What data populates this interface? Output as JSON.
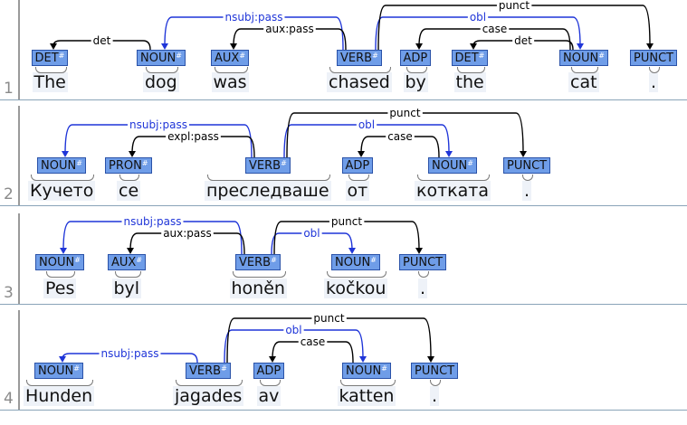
{
  "sentences": [
    {
      "num": "1",
      "tokens": [
        {
          "word": "The",
          "tag": "DET",
          "feat": true
        },
        {
          "word": "dog",
          "tag": "NOUN",
          "feat": true
        },
        {
          "word": "was",
          "tag": "AUX",
          "feat": true
        },
        {
          "word": "chased",
          "tag": "VERB",
          "feat": true
        },
        {
          "word": "by",
          "tag": "ADP",
          "feat": false
        },
        {
          "word": "the",
          "tag": "DET",
          "feat": true
        },
        {
          "word": "cat",
          "tag": "NOUN",
          "feat": true
        },
        {
          "word": ".",
          "tag": "PUNCT",
          "feat": false
        }
      ],
      "arcs": [
        {
          "from": 1,
          "to": 0,
          "label": "det",
          "color": "#000000"
        },
        {
          "from": 3,
          "to": 1,
          "label": "nsubj:pass",
          "color": "#1f35d8"
        },
        {
          "from": 3,
          "to": 2,
          "label": "aux:pass",
          "color": "#000000"
        },
        {
          "from": 6,
          "to": 5,
          "label": "det",
          "color": "#000000"
        },
        {
          "from": 6,
          "to": 4,
          "label": "case",
          "color": "#000000"
        },
        {
          "from": 3,
          "to": 6,
          "label": "obl",
          "color": "#1f35d8"
        },
        {
          "from": 3,
          "to": 7,
          "label": "punct",
          "color": "#000000"
        }
      ]
    },
    {
      "num": "2",
      "tokens": [
        {
          "word": "Кучето",
          "tag": "NOUN",
          "feat": true
        },
        {
          "word": "се",
          "tag": "PRON",
          "feat": true
        },
        {
          "word": "преследваше",
          "tag": "VERB",
          "feat": true
        },
        {
          "word": "от",
          "tag": "ADP",
          "feat": false
        },
        {
          "word": "котката",
          "tag": "NOUN",
          "feat": true
        },
        {
          "word": ".",
          "tag": "PUNCT",
          "feat": false
        }
      ],
      "arcs": [
        {
          "from": 2,
          "to": 0,
          "label": "nsubj:pass",
          "color": "#1f35d8"
        },
        {
          "from": 2,
          "to": 1,
          "label": "expl:pass",
          "color": "#000000"
        },
        {
          "from": 4,
          "to": 3,
          "label": "case",
          "color": "#000000"
        },
        {
          "from": 2,
          "to": 4,
          "label": "obl",
          "color": "#1f35d8"
        },
        {
          "from": 2,
          "to": 5,
          "label": "punct",
          "color": "#000000"
        }
      ]
    },
    {
      "num": "3",
      "tokens": [
        {
          "word": "Pes",
          "tag": "NOUN",
          "feat": true
        },
        {
          "word": "byl",
          "tag": "AUX",
          "feat": true
        },
        {
          "word": "honěn",
          "tag": "VERB",
          "feat": true
        },
        {
          "word": "kočkou",
          "tag": "NOUN",
          "feat": true
        },
        {
          "word": ".",
          "tag": "PUNCT",
          "feat": false
        }
      ],
      "arcs": [
        {
          "from": 2,
          "to": 0,
          "label": "nsubj:pass",
          "color": "#1f35d8"
        },
        {
          "from": 2,
          "to": 1,
          "label": "aux:pass",
          "color": "#000000"
        },
        {
          "from": 2,
          "to": 3,
          "label": "obl",
          "color": "#1f35d8"
        },
        {
          "from": 2,
          "to": 4,
          "label": "punct",
          "color": "#000000"
        }
      ]
    },
    {
      "num": "4",
      "tokens": [
        {
          "word": "Hunden",
          "tag": "NOUN",
          "feat": true
        },
        {
          "word": "jagades",
          "tag": "VERB",
          "feat": true
        },
        {
          "word": "av",
          "tag": "ADP",
          "feat": false
        },
        {
          "word": "katten",
          "tag": "NOUN",
          "feat": true
        },
        {
          "word": ".",
          "tag": "PUNCT",
          "feat": false
        }
      ],
      "arcs": [
        {
          "from": 1,
          "to": 0,
          "label": "nsubj:pass",
          "color": "#1f35d8"
        },
        {
          "from": 3,
          "to": 2,
          "label": "case",
          "color": "#000000"
        },
        {
          "from": 1,
          "to": 3,
          "label": "obl",
          "color": "#1f35d8"
        },
        {
          "from": 1,
          "to": 4,
          "label": "punct",
          "color": "#000000"
        }
      ]
    }
  ]
}
